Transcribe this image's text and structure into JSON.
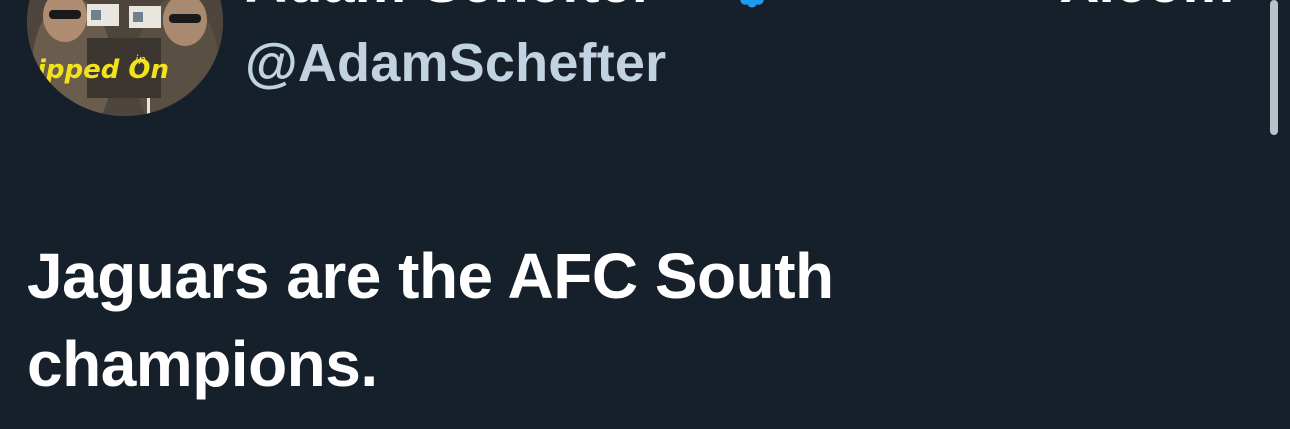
{
  "tweet": {
    "display_name": "Adam Schefter",
    "handle": "@AdamSchefter",
    "source_mark": "X.com",
    "text": "Jaguars are the AFC South champions.",
    "avatar_caption": "Clipped On"
  },
  "icons": {
    "verified": "verified-badge-icon"
  },
  "colors": {
    "background": "#15202b",
    "handle": "#c1d2e0",
    "verified": "#1d9bf0",
    "text": "#ffffff"
  }
}
